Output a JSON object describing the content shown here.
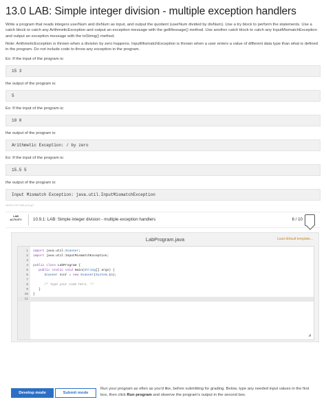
{
  "title": "13.0 LAB: Simple integer division - multiple exception handlers",
  "description": "Write a program that reads integers userNum and divNum as input, and output the quotient (userNum divided by divNum). Use a try block to perform the statements. Use a catch block to catch any ArithmeticException and output an exception message with the getMessage() method. Use another catch block to catch any InputMismatchException and output an exception message with the toString() method.",
  "note": "Note: ArithmeticException is thrown when a division by zero happens. InputMismatchException is thrown when a user enters a value of different data type than what is defined in the program. Do not include code to throw any exception in the program.",
  "examples": [
    {
      "input_label": "Ex: If the input of the program is:",
      "input": "15 3",
      "output_label": "the output of the program is:",
      "output": "5"
    },
    {
      "input_label": "Ex: If the input of the program is:",
      "input": "10 0",
      "output_label": "the output of the program is:",
      "output": "Arithmetic Exception: / by zero"
    },
    {
      "input_label": "Ex: If the input of the program is:",
      "input": "15.5 5",
      "output_label": "the output of the program is:",
      "output": "Input Mismatch Exception: java.util.InputMismatchException"
    }
  ],
  "activity_id": "464002.2871488.qx3zqy7",
  "lab": {
    "tag_line1": "LAB",
    "tag_line2": "ACTIVITY",
    "title": "10.9.1: LAB: Simple integer division - multiple exception handlers",
    "score": "6 / 10"
  },
  "editor": {
    "file_name": "LabProgram.java",
    "template_link": "Load default template...",
    "lines": [
      {
        "n": "1",
        "text": "import java.util.Scanner;"
      },
      {
        "n": "2",
        "text": "import java.util.InputMismatchException;"
      },
      {
        "n": "3",
        "text": ""
      },
      {
        "n": "4",
        "text": "public class LabProgram {"
      },
      {
        "n": "5",
        "text": "   public static void main(String[] args) {"
      },
      {
        "n": "6",
        "text": "      Scanner scnr = new Scanner(System.in);"
      },
      {
        "n": "7",
        "text": ""
      },
      {
        "n": "8",
        "text": "      /* Type your code here. */"
      },
      {
        "n": "9",
        "text": "   }"
      },
      {
        "n": "10",
        "text": "}"
      },
      {
        "n": "11",
        "text": ""
      }
    ],
    "active_line": 11
  },
  "modes": {
    "develop_label": "Develop mode",
    "submit_label": "Submit mode",
    "description_pre": "Run your program as often as you'd like, before submitting for grading. Below, type any needed input values in the first box, then click ",
    "description_bold": "Run program",
    "description_post": " and observe the program's output in the second box."
  },
  "colors": {
    "accent": "#2d6fc5",
    "link": "#c98a2a"
  }
}
